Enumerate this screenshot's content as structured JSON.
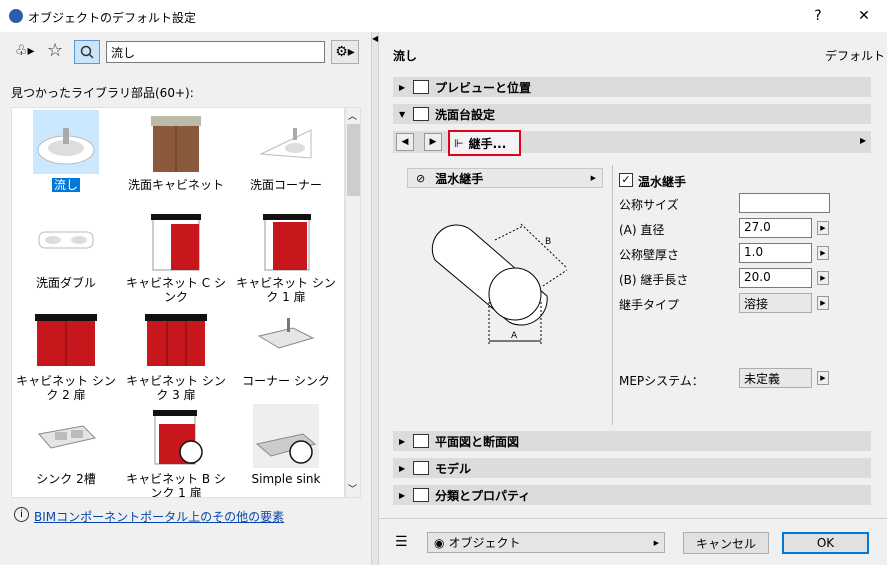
{
  "window": {
    "title": "オブジェクトのデフォルト設定",
    "help": "?",
    "close": "✕"
  },
  "left": {
    "search_value": "流し",
    "found_label": "見つかったライブラリ部品(60+):",
    "items": [
      {
        "label": "流し"
      },
      {
        "label": "洗面キャビネット"
      },
      {
        "label": "洗面コーナー"
      },
      {
        "label": "洗面ダブル"
      },
      {
        "label": "キャビネット C シンク"
      },
      {
        "label": "キャビネット シンク 1 扉"
      },
      {
        "label": "キャビネット シンク 2 扉"
      },
      {
        "label": "キャビネット シンク 3 扉"
      },
      {
        "label": "コーナー シンク"
      },
      {
        "label": "シンク 2槽"
      },
      {
        "label": "キャビネット B シンク 1 扉"
      },
      {
        "label": "Simple sink"
      }
    ],
    "bim_link": "BIMコンポーネントポータル上のその他の要素"
  },
  "right": {
    "object_name": "流し",
    "default_label": "デフォルト",
    "sections": {
      "preview": "プレビューと位置",
      "washbasin": "洗面台設定",
      "floorplan": "平面図と断面図",
      "model": "モデル",
      "classification": "分類とプロパティ"
    },
    "subpage": "継手...",
    "dropdown": "温水継手",
    "checkbox_label": "温水継手",
    "params": [
      {
        "label": "公称サイズ",
        "value": ""
      },
      {
        "label": "(A) 直径",
        "value": "27.0"
      },
      {
        "label": "公称壁厚さ",
        "value": "1.0"
      },
      {
        "label": "(B) 継手長さ",
        "value": "20.0"
      },
      {
        "label": "継手タイプ",
        "value": "溶接"
      }
    ],
    "mep_label": "MEPシステム：",
    "mep_value": "未定義",
    "diagram_labels": {
      "a": "A",
      "b": "B"
    },
    "layer_value": "オブジェクト",
    "cancel": "キャンセル",
    "ok": "OK"
  }
}
